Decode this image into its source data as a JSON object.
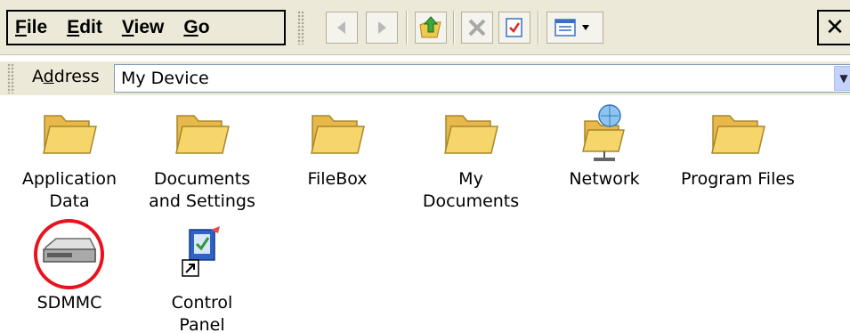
{
  "menu": {
    "items": [
      {
        "label": "File"
      },
      {
        "label": "Edit"
      },
      {
        "label": "View"
      },
      {
        "label": "Go"
      }
    ],
    "close_label": "✕"
  },
  "toolbar": {
    "icons": [
      "back-arrow-icon",
      "forward-arrow-icon",
      "up-folder-icon",
      "delete-icon",
      "properties-icon",
      "views-menu-icon"
    ]
  },
  "address": {
    "label_pre": "A",
    "label_ul": "d",
    "label_post": "dress",
    "value": "My Device"
  },
  "items": [
    {
      "label": "Application\nData",
      "icon": "folder-icon"
    },
    {
      "label": "Documents\nand Settings",
      "icon": "folder-icon"
    },
    {
      "label": "FileBox",
      "icon": "folder-icon"
    },
    {
      "label": "My\nDocuments",
      "icon": "folder-icon"
    },
    {
      "label": "Network",
      "icon": "network-folder-icon"
    },
    {
      "label": "Program Files",
      "icon": "folder-icon"
    },
    {
      "label": "SDMMC",
      "icon": "storage-card-icon"
    },
    {
      "label": "Control\nPanel",
      "icon": "control-panel-shortcut-icon"
    }
  ],
  "colors": {
    "toolbar_bg": "#ece9d8",
    "folder_yellow": "#f6d66a",
    "highlight_ring": "#e8131f"
  }
}
